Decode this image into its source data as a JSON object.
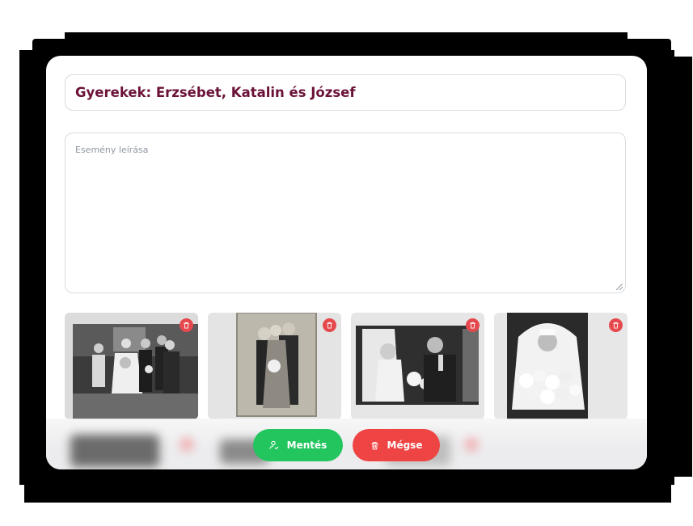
{
  "form": {
    "title_value": "Gyerekek: Erzsébet, Katalin és József",
    "description_placeholder": "Esemény leírása"
  },
  "gallery": {
    "photos": [
      {
        "description": "group wedding photo",
        "delete_icon": "trash-icon"
      },
      {
        "description": "couple with best man",
        "delete_icon": "trash-icon"
      },
      {
        "description": "couple portrait",
        "delete_icon": "trash-icon"
      },
      {
        "description": "bride with bouquet",
        "delete_icon": "trash-icon"
      }
    ]
  },
  "actions": {
    "save_label": "Mentés",
    "cancel_label": "Mégse",
    "save_icon": "user-check-icon",
    "cancel_icon": "trash-icon",
    "save_color": "#22c55e",
    "cancel_color": "#ef4444"
  },
  "colors": {
    "title_text": "#6b1238",
    "delete_badge": "#e5484d"
  }
}
